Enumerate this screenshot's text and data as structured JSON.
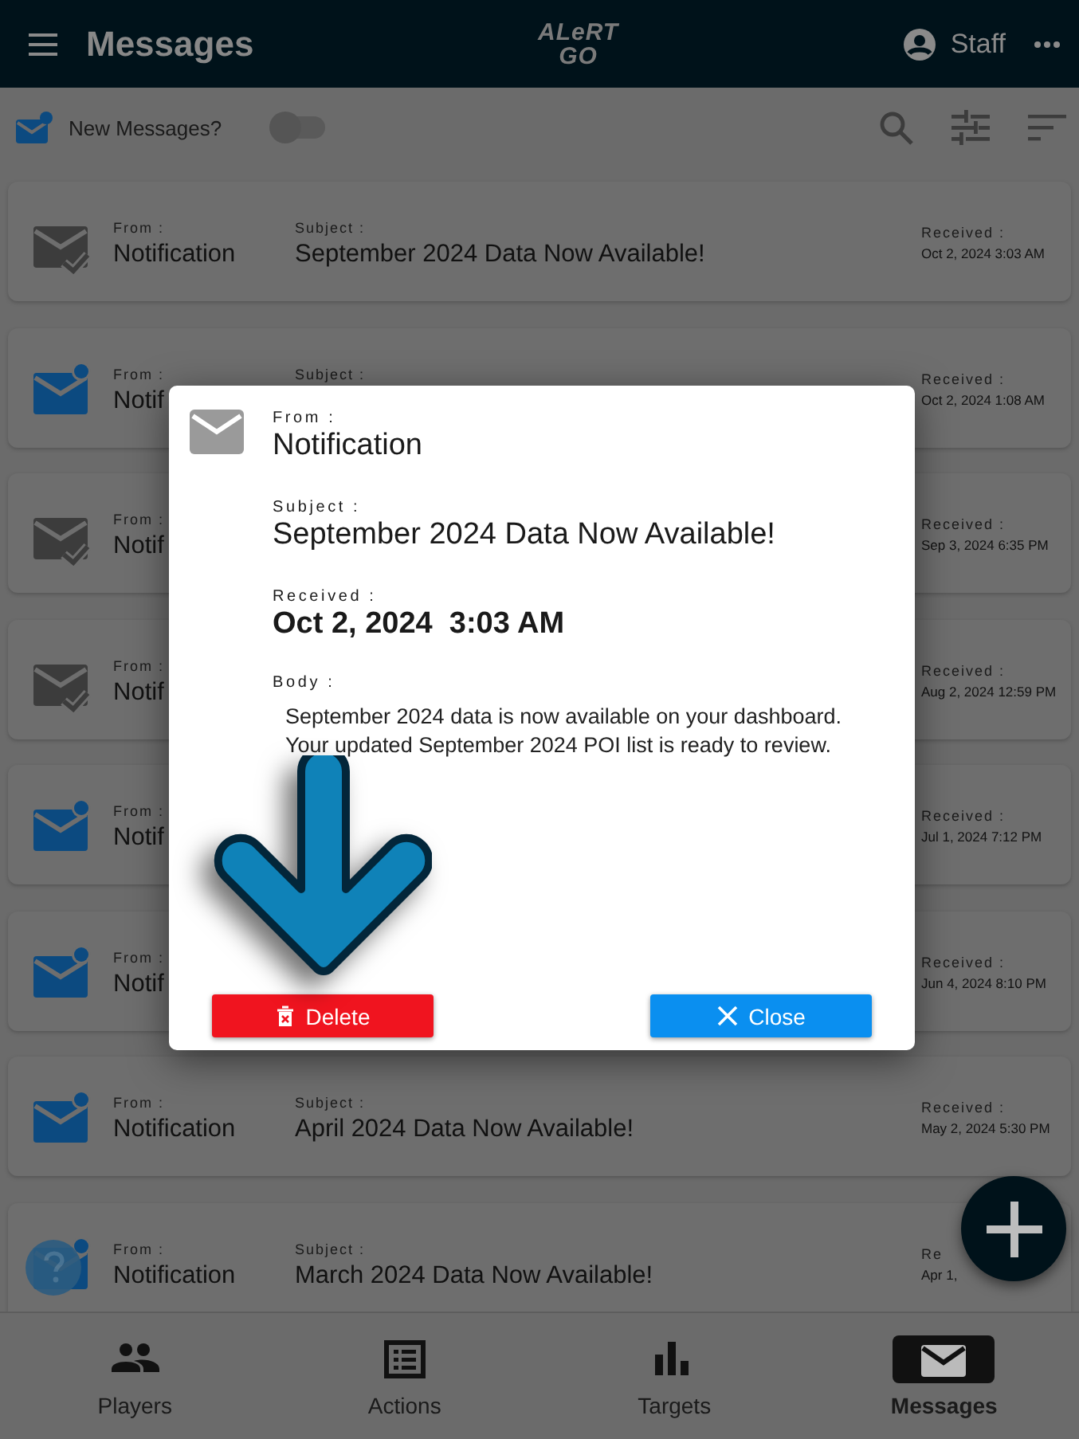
{
  "header": {
    "title": "Messages",
    "logo_top": "ALeRT",
    "logo_bottom": "GO",
    "user": "Staff"
  },
  "toolbar": {
    "new_messages_label": "New Messages?",
    "new_messages_toggle": {
      "on": false
    }
  },
  "messages": [
    {
      "read": true,
      "from_label": "From :",
      "from": "Notification",
      "subject_label": "Subject :",
      "subject": "September 2024 Data Now Available!",
      "received_label": "Received :",
      "received": "Oct 2, 2024 3:03 AM"
    },
    {
      "read": false,
      "from_label": "From :",
      "from": "Notif",
      "subject_label": "Subject :",
      "received_label": "Received :",
      "received": "Oct 2, 2024 1:08 AM"
    },
    {
      "read": true,
      "from_label": "From :",
      "from": "Notif",
      "received_label": "Received :",
      "received": "Sep 3, 2024 6:35 PM"
    },
    {
      "read": true,
      "from_label": "From :",
      "from": "Notif",
      "received_label": "Received :",
      "received": "Aug 2, 2024 12:59 PM"
    },
    {
      "read": false,
      "from_label": "From :",
      "from": "Notif",
      "received_label": "Received :",
      "received": "Jul 1, 2024 7:12 PM"
    },
    {
      "read": false,
      "from_label": "From :",
      "from": "Notif",
      "received_label": "Received :",
      "received": "Jun 4, 2024 8:10 PM"
    },
    {
      "read": false,
      "from_label": "From :",
      "from": "Notification",
      "subject_label": "Subject :",
      "subject": "April 2024 Data Now Available!",
      "received_label": "Received :",
      "received": "May 2, 2024 5:30 PM"
    },
    {
      "read": false,
      "from_label": "From :",
      "from": "Notification",
      "subject_label": "Subject :",
      "subject": "March 2024 Data Now Available!",
      "received_label": "Re",
      "received": "Apr 1,"
    }
  ],
  "dialog": {
    "from_label": "From :",
    "from": "Notification",
    "subject_label": "Subject :",
    "subject": "September 2024 Data Now Available!",
    "received_label": "Received :",
    "received": "Oct 2, 2024  3:03 AM",
    "body_label": "Body :",
    "body": "September 2024 data is now available on your dashboard. Your updated September 2024 POI list is ready to review.",
    "buttons": [
      {
        "kind": "delete",
        "label": "Delete"
      },
      {
        "kind": "close",
        "label": "Close"
      }
    ]
  },
  "bottom_nav": [
    {
      "kind": "players",
      "label": "Players",
      "selected": false
    },
    {
      "kind": "actions",
      "label": "Actions",
      "selected": false
    },
    {
      "kind": "targets",
      "label": "Targets",
      "selected": false
    },
    {
      "kind": "messages",
      "label": "Messages",
      "selected": true
    }
  ]
}
